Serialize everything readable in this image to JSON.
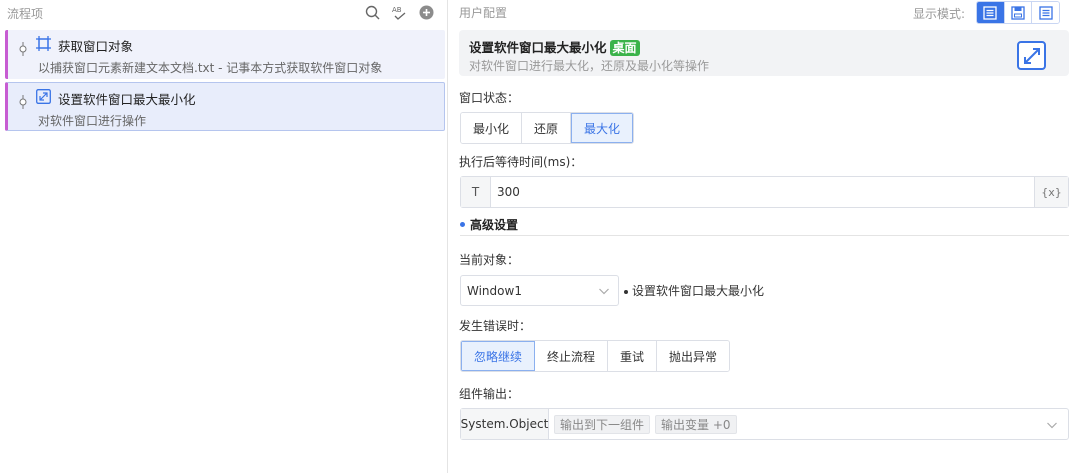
{
  "left_panel": {
    "title": "流程项",
    "tools": [
      "search-icon",
      "spellcheck-icon",
      "add-circle-icon"
    ],
    "items": [
      {
        "title": "获取窗口对象",
        "subtitle": "以捕获窗口元素新建文本文档.txt - 记事本方式获取软件窗口对象",
        "icon": "window-capture-icon"
      },
      {
        "title": "设置软件窗口最大最小化",
        "subtitle": "对软件窗口进行操作",
        "icon": "window-resize-icon"
      }
    ]
  },
  "right_panel": {
    "title": "用户配置",
    "display_mode_label": "显示模式:",
    "display_modes": [
      "mode-full-icon",
      "mode-save-icon",
      "mode-list-icon"
    ],
    "card": {
      "title": "设置软件窗口最大最小化",
      "badge": "桌面",
      "description": "对软件窗口进行最大化，还原及最小化等操作",
      "icon": "expand-arrows-icon"
    },
    "window_state": {
      "label": "窗口状态：",
      "options": [
        "最小化",
        "还原",
        "最大化"
      ],
      "selected": "最大化"
    },
    "wait_time": {
      "label": "执行后等待时间(ms)：",
      "prefix": "T",
      "value": "300",
      "suffix": "{x}"
    },
    "advanced": {
      "label": "高级设置"
    },
    "current_object": {
      "label": "当前对象：",
      "value": "Window1",
      "note": "设置软件窗口最大最小化"
    },
    "on_error": {
      "label": "发生错误时：",
      "options": [
        "忽略继续",
        "终止流程",
        "重试",
        "抛出异常"
      ],
      "selected": "忽略继续"
    },
    "output": {
      "label": "组件输出：",
      "type": "System.Object",
      "tags": [
        "输出到下一组件",
        "输出变量 +0"
      ]
    }
  },
  "colors": {
    "accent": "#3a74e6",
    "badge_green": "#3bb34a",
    "flow_bar": "#c75cd2"
  }
}
